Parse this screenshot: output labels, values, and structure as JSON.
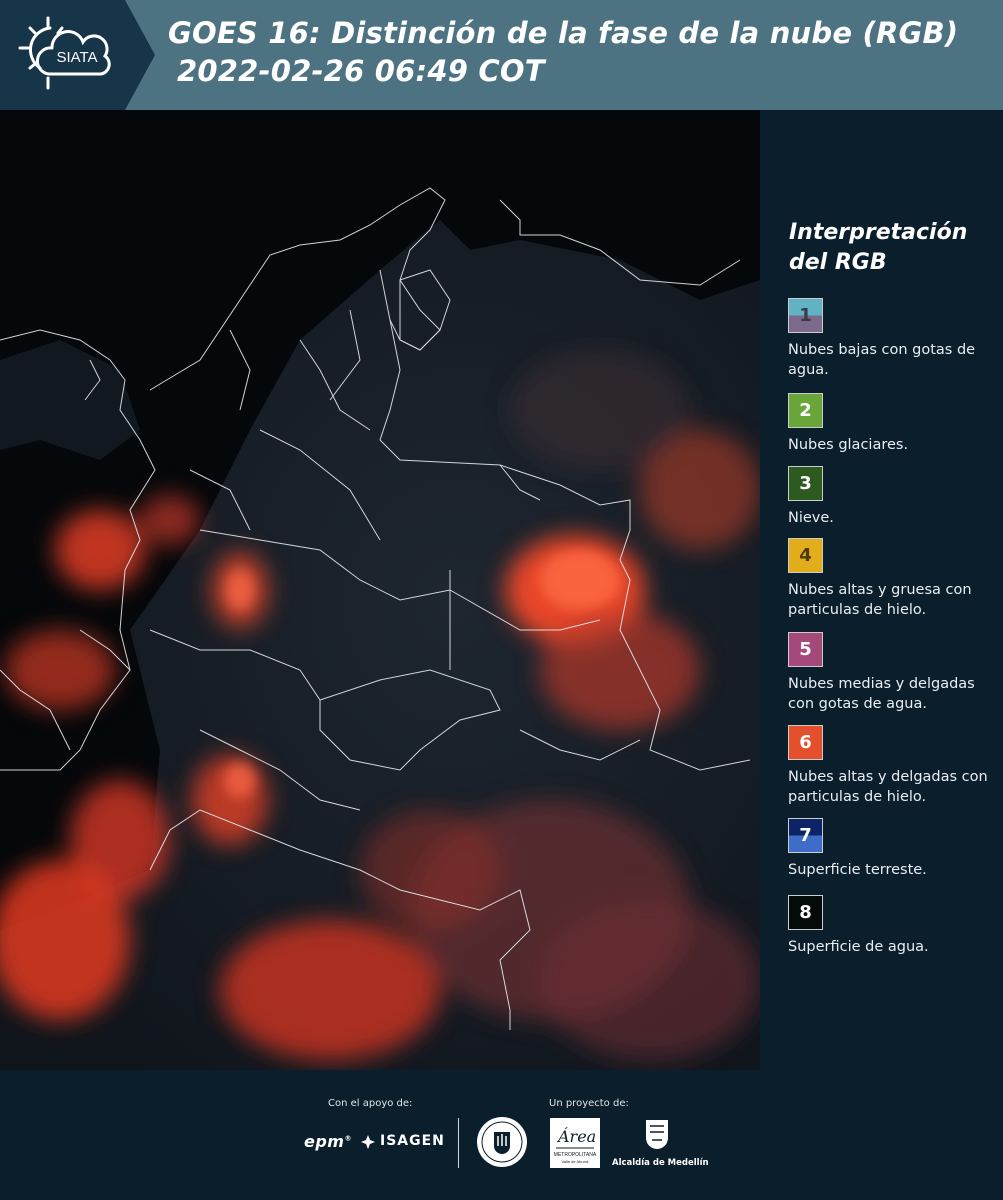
{
  "header": {
    "logo_text": "SIATA",
    "title_line1": "GOES 16: Distinción de la fase de la nube (RGB)",
    "title_line2": "2022-02-26 06:49 COT"
  },
  "legend": {
    "title": "Interpretación del RGB",
    "items": [
      {
        "number": "1",
        "label": "Nubes bajas con gotas de agua.",
        "color_top": "#5fb3c4",
        "color_bottom": "#7b6a8c"
      },
      {
        "number": "2",
        "label": "Nubes glaciares.",
        "color": "#6aa53a"
      },
      {
        "number": "3",
        "label": "Nieve.",
        "color": "#2d5a1f"
      },
      {
        "number": "4",
        "label": "Nubes altas y gruesa con particulas de hielo.",
        "color": "#e2ad1a"
      },
      {
        "number": "5",
        "label": "Nubes medias y delgadas con gotas de agua.",
        "color": "#a5497a"
      },
      {
        "number": "6",
        "label": "Nubes altas y delgadas con particulas de hielo.",
        "color": "#e5502c"
      },
      {
        "number": "7",
        "label": "Superficie terreste.",
        "color_top": "#0c2466",
        "color_bottom": "#3f6bc9"
      },
      {
        "number": "8",
        "label": "Superficie de agua.",
        "color": "#050b08"
      }
    ]
  },
  "footer": {
    "support_label": "Con el apoyo de:",
    "project_label": "Un proyecto de:",
    "sponsor1": "epm",
    "sponsor2": "ISAGEN",
    "partner_area": "METROPOLITANA",
    "partner_area_sub": "Valle de Aburrá",
    "partner_alcaldia": "Alcaldía de Medellín"
  }
}
